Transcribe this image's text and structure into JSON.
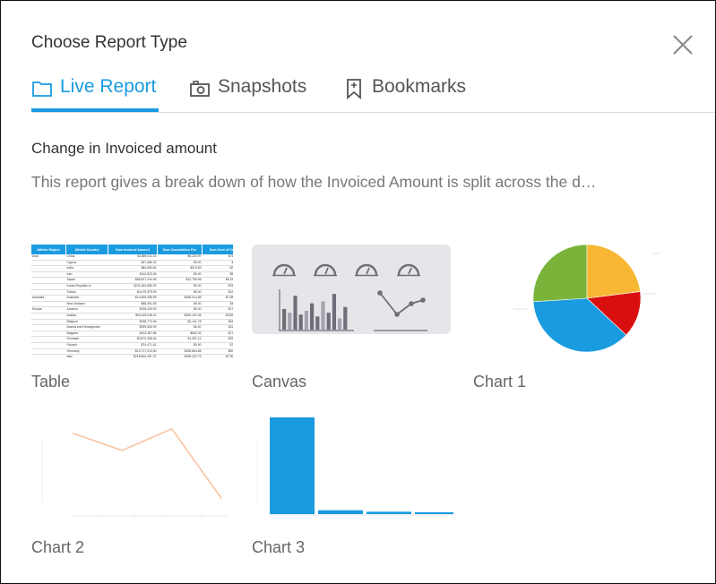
{
  "dialog": {
    "title": "Choose Report Type"
  },
  "tabs": [
    {
      "label": "Live Report",
      "icon": "folder-icon",
      "active": true
    },
    {
      "label": "Snapshots",
      "icon": "camera-icon",
      "active": false
    },
    {
      "label": "Bookmarks",
      "icon": "bookmark-icon",
      "active": false
    }
  ],
  "report": {
    "name": "Change in Invoiced amount",
    "description": "This report gives a break down of how the Invoiced Amount is split across the d…"
  },
  "cards": [
    {
      "label": "Table"
    },
    {
      "label": "Canvas"
    },
    {
      "label": "Chart 1"
    },
    {
      "label": "Chart 2"
    },
    {
      "label": "Chart 3"
    }
  ],
  "table_preview": {
    "headers": [
      "Athlete Region",
      "Athlete Country",
      "Sum Invoiced Amount",
      "Sum Cancellation Fee",
      "Sum Cost of Camp"
    ],
    "rows": [
      [
        "Asia",
        "China",
        "$3,889,011.92",
        "$9,220.97",
        "$769,691.11"
      ],
      [
        "",
        "Cyprus",
        "$47,386.32",
        "$0.00",
        "$4,515.07"
      ],
      [
        "",
        "India",
        "$84,693.84",
        "$570.83",
        "$23,334.21"
      ],
      [
        "",
        "Iran",
        "$142,623.08",
        "$0.00",
        "$54,941.22"
      ],
      [
        "",
        "Japan",
        "$86,827,244.06",
        "$22,796.96",
        "$5,154,246.22"
      ],
      [
        "",
        "Korea Republic of",
        "$211,163,865.30",
        "$0.00",
        "$789,572.13"
      ],
      [
        "",
        "Turkey",
        "$4,079,375.90",
        "$0.00",
        "$124,686.90"
      ],
      [
        "Australia",
        "Australia",
        "$14,505,338.55",
        "$186,014.55",
        "$7,988,775.53"
      ],
      [
        "",
        "New Zealand",
        "$88,051.53",
        "$0.00",
        "$46,646.35"
      ],
      [
        "Europe",
        "Andorra",
        "$235,425.00",
        "$0.00",
        "$174,029.54"
      ],
      [
        "",
        "Austria",
        "$93,449,918.11",
        "$330,102.36",
        "$3,897,596.66"
      ],
      [
        "",
        "Belgium",
        "$938,770.06",
        "$2,141.78",
        "$180,105.32"
      ],
      [
        "",
        "Bosnia and Herzegovina",
        "$399,526.99",
        "$0.00",
        "$221,911.33"
      ],
      [
        "",
        "Bulgaria",
        "$313,387.86",
        "$660.32",
        "$176,291.39"
      ],
      [
        "",
        "Denmark",
        "$3,870,398.54",
        "$1,391.12",
        "$328,646.55"
      ],
      [
        "",
        "Finland",
        "$74,471.61",
        "$0.00",
        "$79,670.08"
      ],
      [
        "",
        "Germany",
        "$13,717,210.00",
        "$156,864.68",
        "$903,407.98"
      ],
      [
        "",
        "Italy",
        "$218,843,287.37",
        "$198,222.75",
        "$7,902,202.37"
      ],
      [
        "",
        "Netherlands",
        "$568,860.92",
        "$0.00",
        "$57,540.68"
      ],
      [
        "",
        "Norway",
        "$529,101.86",
        "$0.00",
        "$73,464.17"
      ]
    ]
  },
  "canvas_preview": {
    "bars_left": [
      0.55,
      0.45,
      0.9,
      0.4,
      0.5,
      0.7,
      0.35,
      0.75,
      0.45,
      0.95,
      0.3,
      0.6
    ],
    "line_points": [
      0.95,
      0.35,
      0.65,
      0.75
    ]
  },
  "pie_preview": {
    "slices": [
      {
        "value": 0.14,
        "color": "#d90f0f"
      },
      {
        "value": 0.37,
        "color": "#1a9be0"
      },
      {
        "value": 0.26,
        "color": "#7ab33a"
      },
      {
        "value": 0.23,
        "color": "#f7b733"
      }
    ]
  },
  "line_preview": {
    "values": [
      0.85,
      0.65,
      0.9,
      0.1
    ]
  },
  "bar_preview": {
    "values": [
      1.0,
      0.04,
      0.025,
      0.02
    ]
  },
  "colors": {
    "accent": "#1a9be0",
    "canvas_bg": "#e6e6ea",
    "canvas_ink": "#6e6e78"
  }
}
